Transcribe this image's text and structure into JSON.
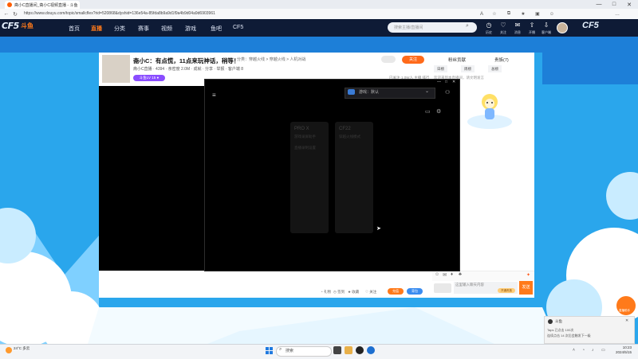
{
  "browser": {
    "tab_title": "斋小C直播间_斋小C视频直播 - 斗鱼",
    "url": "https://www.douyu.com/topic/smallcflex?rid=520868&dyshid=136e54a-85fda8b9a9d1f9a4b9d04a9d6903961",
    "window_controls": [
      "—",
      "□",
      "✕"
    ]
  },
  "site_nav": {
    "logo": "CF5",
    "logo_sub": "斗鱼",
    "items": [
      "首页",
      "直播",
      "分类",
      "赛事",
      "视频",
      "游戏",
      "鱼吧",
      "CF5"
    ],
    "active_index": 1,
    "search_placeholder": "搜索主播/直播间",
    "header_icons": [
      {
        "icon": "history-icon",
        "label": "历史"
      },
      {
        "icon": "follow-icon",
        "label": "关注"
      },
      {
        "icon": "message-icon",
        "label": "消息"
      },
      {
        "icon": "upload-icon",
        "label": "开播"
      },
      {
        "icon": "download-icon",
        "label": "客户端"
      }
    ],
    "right_logo": "CF5"
  },
  "stream": {
    "title": "斋小C：有点慌，11点来玩神话，稍等！",
    "category": "分类：穿越火线 > 穿越火线 > 人机对战",
    "meta": "斋小C直播 · 4394  ·  亲密度 2.0M  ·  成就  ·  分享  ·  举报  ·  客户端 8",
    "level_badge": "斗鱼LV 15  ●",
    "follow_label": "关注",
    "top_info": "已关注·1.0W人 主播 排行"
  },
  "side_panel": {
    "tab_rank": "粉丝贡献",
    "tab_noble": "贵族(7)",
    "tabs": [
      "日榜",
      "周榜",
      "总榜"
    ],
    "notice": "欢迎来到本直播间，请文明发言",
    "chat_placeholder": "这里输入聊天内容",
    "vip_label": "开通贵族",
    "send_label": "发送"
  },
  "player_bottom": {
    "items": [
      "★ 收藏",
      "♡ 关注",
      "◔ 礼物",
      "◷ 签到"
    ],
    "btn_orange": "充值",
    "btn_blue": "背包"
  },
  "floating_window": {
    "dropdown_label": "游戏：默认",
    "cards": [
      {
        "title": "PRO X",
        "subtitle": "游戏录屏助手",
        "line2": "直播录制设置"
      },
      {
        "title": "CF22",
        "subtitle": "穿越火线模式"
      }
    ]
  },
  "toast": {
    "app": "斗鱼",
    "line1": "Taps 已点击 100次",
    "line2": "连续点击 14 次后会触发下一级"
  },
  "float_help": {
    "label": "直播助手"
  },
  "taskbar": {
    "weather": "24°C 多云",
    "search_label": "搜索",
    "time": "10:23",
    "date": "2024/5/15"
  },
  "colors": {
    "accent": "#ff6a1a",
    "nav_bg": "#0e1b36",
    "page_bg": "#2aa6ec",
    "badge": "#8a4dff"
  }
}
